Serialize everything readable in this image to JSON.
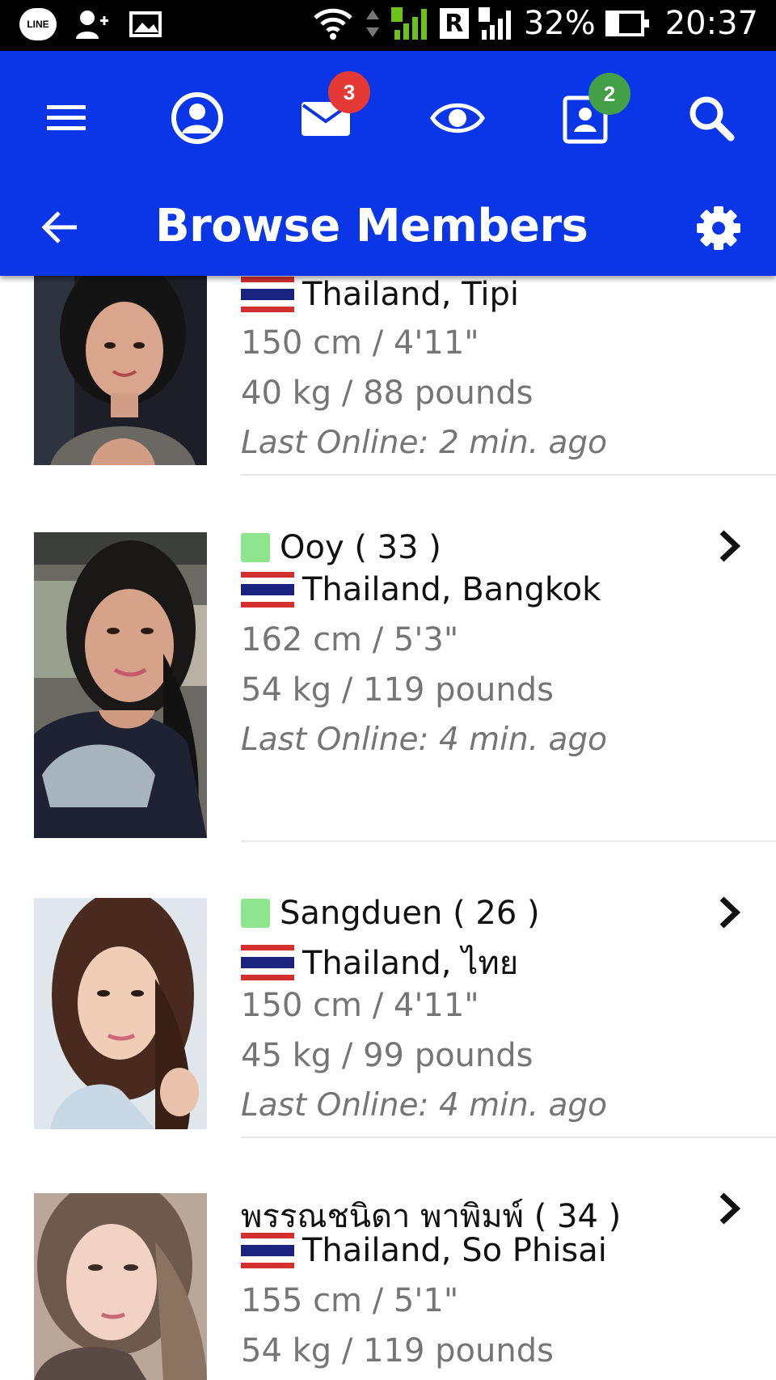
{
  "status_bar": {
    "line_label": "LINE",
    "r_label": "R",
    "battery_percent": "32%",
    "battery_level": 0.32,
    "time": "20:37"
  },
  "app_bar": {
    "icons": [
      "menu-icon",
      "profile-icon",
      "mail-icon",
      "eye-icon",
      "contacts-icon",
      "search-icon"
    ],
    "mail_badge": "3",
    "contacts_badge": "2",
    "title": "Browse Members",
    "colors": {
      "bar": "#0a36e8",
      "badge_red": "#e53935",
      "badge_green": "#43a047"
    }
  },
  "members": [
    {
      "name": "",
      "online": false,
      "location": "Thailand, Tipi",
      "height": "150 cm / 4'11\"",
      "weight": "40 kg / 88 pounds",
      "last_online": "Last Online: 2 min. ago",
      "partial_top": true
    },
    {
      "name": "Ooy ( 33 )",
      "online": true,
      "location": "Thailand, Bangkok",
      "height": "162 cm / 5'3\"",
      "weight": "54 kg / 119 pounds",
      "last_online": "Last Online: 4 min. ago"
    },
    {
      "name": "Sangduen ( 26 )",
      "online": true,
      "location": "Thailand, ไทย",
      "height": "150 cm / 4'11\"",
      "weight": "45 kg / 99 pounds",
      "last_online": "Last Online: 4 min. ago"
    },
    {
      "name": "พรรณชนิดา พาพิมพ์ ( 34 )",
      "online": false,
      "location": "Thailand, So Phisai",
      "height": "155 cm / 5'1\"",
      "weight": "54 kg / 119 pounds",
      "last_online": ""
    }
  ],
  "colors": {
    "online_indicator": "#8ee58e",
    "secondary_text": "#757575",
    "divider": "#e6e6e6"
  }
}
